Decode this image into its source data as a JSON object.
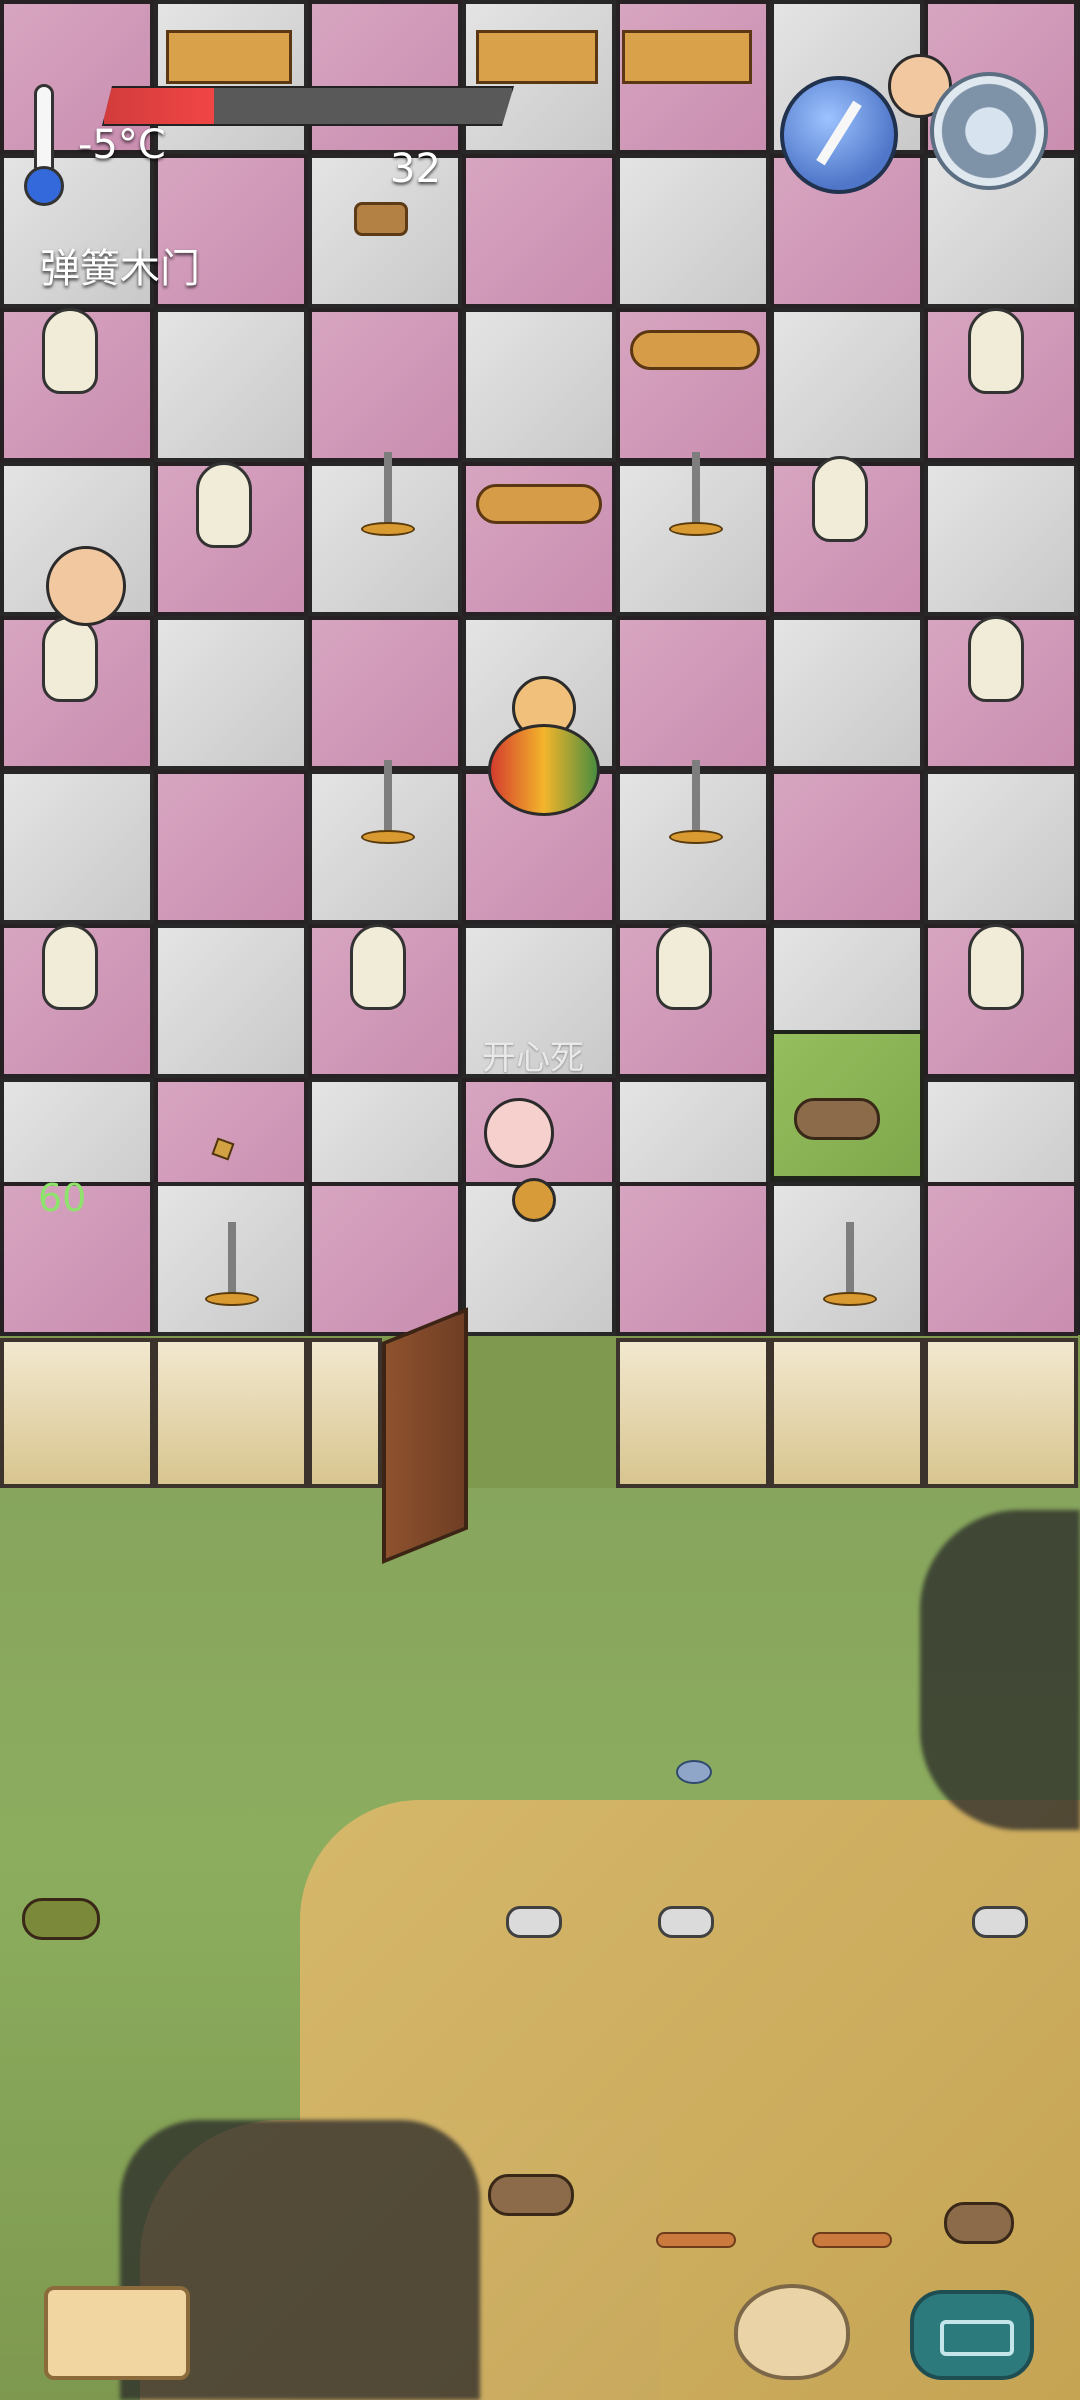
{
  "hud": {
    "temperature": "-5°C",
    "food_count": "32",
    "item_title": "弹簧木门",
    "health_fill": 0.27,
    "green_counter": "60",
    "emote_text": "开心死"
  },
  "icons": {
    "thermometer": "thermometer-icon",
    "compass": "compass-icon",
    "settings": "settings-gear-icon",
    "book": "book-icon",
    "emote": "emote-face-icon",
    "keyboard": "keyboard-icon"
  }
}
